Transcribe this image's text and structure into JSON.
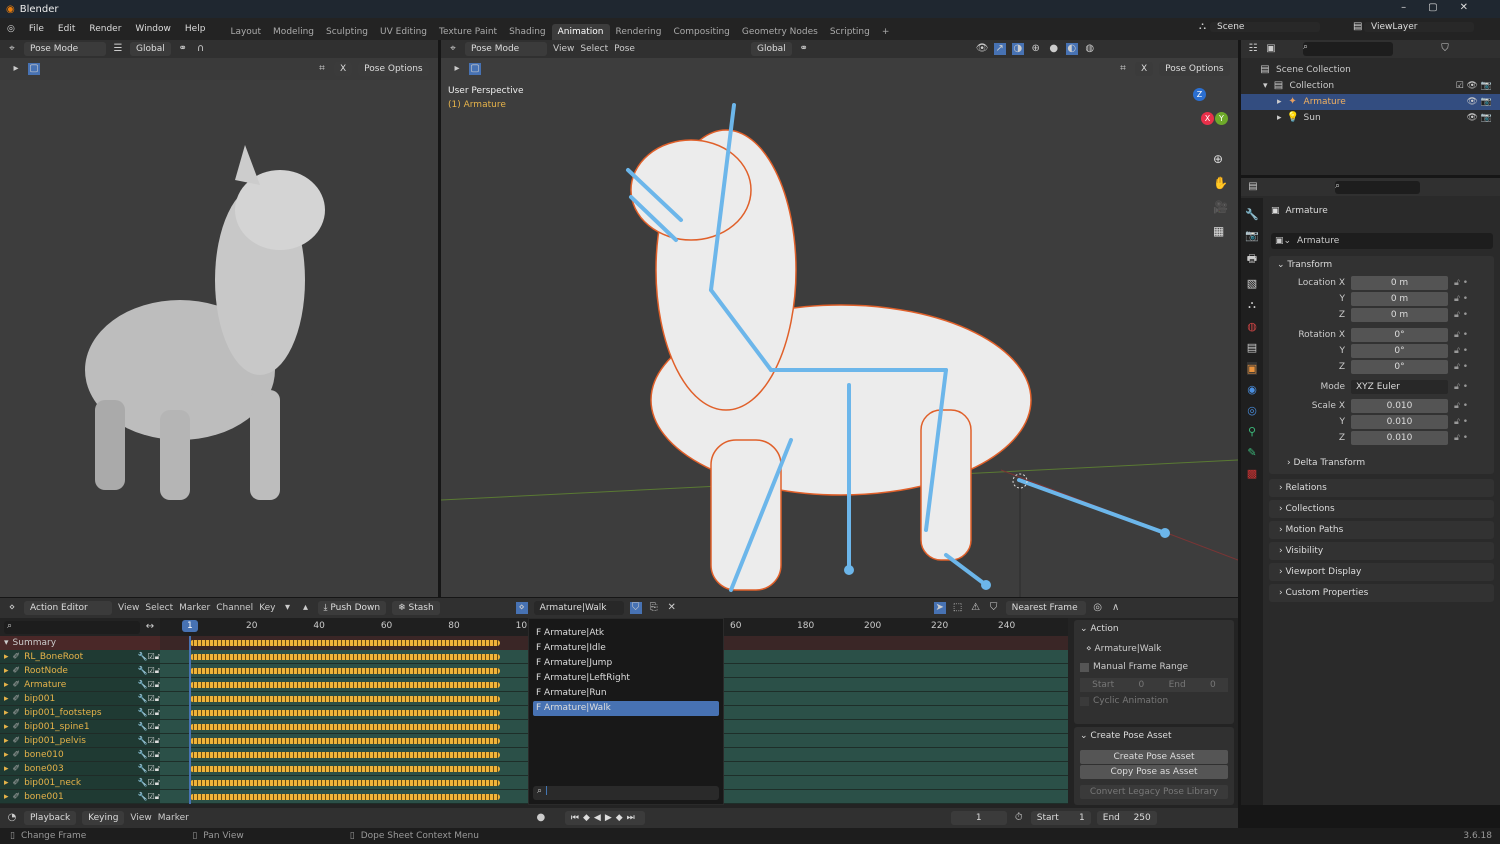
{
  "app": {
    "title": "Blender",
    "version": "3.6.18"
  },
  "menu": [
    "File",
    "Edit",
    "Render",
    "Window",
    "Help"
  ],
  "workspaces": [
    "Layout",
    "Modeling",
    "Sculpting",
    "UV Editing",
    "Texture Paint",
    "Shading",
    "Animation",
    "Rendering",
    "Compositing",
    "Geometry Nodes",
    "Scripting"
  ],
  "active_workspace": "Animation",
  "scene": "Scene",
  "view_layer": "ViewLayer",
  "viewport_left": {
    "mode": "Pose Mode",
    "orientation": "Global",
    "pose_options": "Pose Options",
    "x_label": "X"
  },
  "viewport_right": {
    "mode": "Pose Mode",
    "menus": [
      "View",
      "Select",
      "Pose"
    ],
    "orientation": "Global",
    "pose_options": "Pose Options",
    "x_label": "X",
    "perspective": "User Perspective",
    "object": "(1) Armature",
    "gizmo": {
      "z": "Z",
      "x": "X",
      "y": "Y"
    }
  },
  "outliner": {
    "items": [
      {
        "label": "Scene Collection"
      },
      {
        "label": "Collection"
      },
      {
        "label": "Armature",
        "selected": true
      },
      {
        "label": "Sun"
      }
    ]
  },
  "properties": {
    "object_name": "Armature",
    "data_name": "Armature",
    "transform_title": "Transform",
    "location": {
      "label": "Location X",
      "x": "0 m",
      "y": "0 m",
      "z": "0 m"
    },
    "rotation": {
      "label": "Rotation X",
      "x": "0°",
      "y": "0°",
      "z": "0°"
    },
    "mode_label": "Mode",
    "mode": "XYZ Euler",
    "scale": {
      "label": "Scale X",
      "x": "0.010",
      "y": "0.010",
      "z": "0.010"
    },
    "axis": {
      "y": "Y",
      "z": "Z"
    },
    "delta": "Delta Transform",
    "sections": [
      "Relations",
      "Collections",
      "Motion Paths",
      "Visibility",
      "Viewport Display",
      "Custom Properties"
    ]
  },
  "dopesheet": {
    "editor": "Action Editor",
    "menus": [
      "View",
      "Select",
      "Marker",
      "Channel",
      "Key"
    ],
    "push_down": "Push Down",
    "stash": "Stash",
    "action": "Armature|Walk",
    "snap": "Nearest Frame",
    "frame_ticks_left": [
      "20",
      "40",
      "60",
      "80",
      "10"
    ],
    "frame_ticks_right": [
      "60",
      "180",
      "200",
      "220",
      "240"
    ],
    "current_frame": "1",
    "summary": "Summary",
    "channels": [
      "RL_BoneRoot",
      "RootNode",
      "Armature",
      "bip001",
      "bip001_footsteps",
      "bip001_spine1",
      "bip001_pelvis",
      "bone010",
      "bone003",
      "bip001_neck",
      "bone001"
    ],
    "key_range_frames": [
      1,
      93
    ],
    "action_dropdown": [
      "F Armature|Atk",
      "F Armature|Idle",
      "F Armature|Jump",
      "F Armature|LeftRight",
      "F Armature|Run",
      "F Armature|Walk"
    ],
    "selected_action": "F Armature|Walk",
    "side": {
      "action_title": "Action",
      "action_name": "Armature|Walk",
      "manual_range": "Manual Frame Range",
      "start": "Start",
      "start_val": "0",
      "end": "End",
      "end_val": "0",
      "cyclic": "Cyclic Animation",
      "pose_title": "Create Pose Asset",
      "create": "Create Pose Asset",
      "copy": "Copy Pose as Asset",
      "convert": "Convert Legacy Pose Library"
    }
  },
  "timeline": {
    "menus": [
      "Playback",
      "Keying",
      "View",
      "Marker"
    ],
    "frame": "1",
    "start_label": "Start",
    "start": "1",
    "end_label": "End",
    "end": "250"
  },
  "status": [
    "Change Frame",
    "Pan View",
    "Dope Sheet Context Menu"
  ]
}
